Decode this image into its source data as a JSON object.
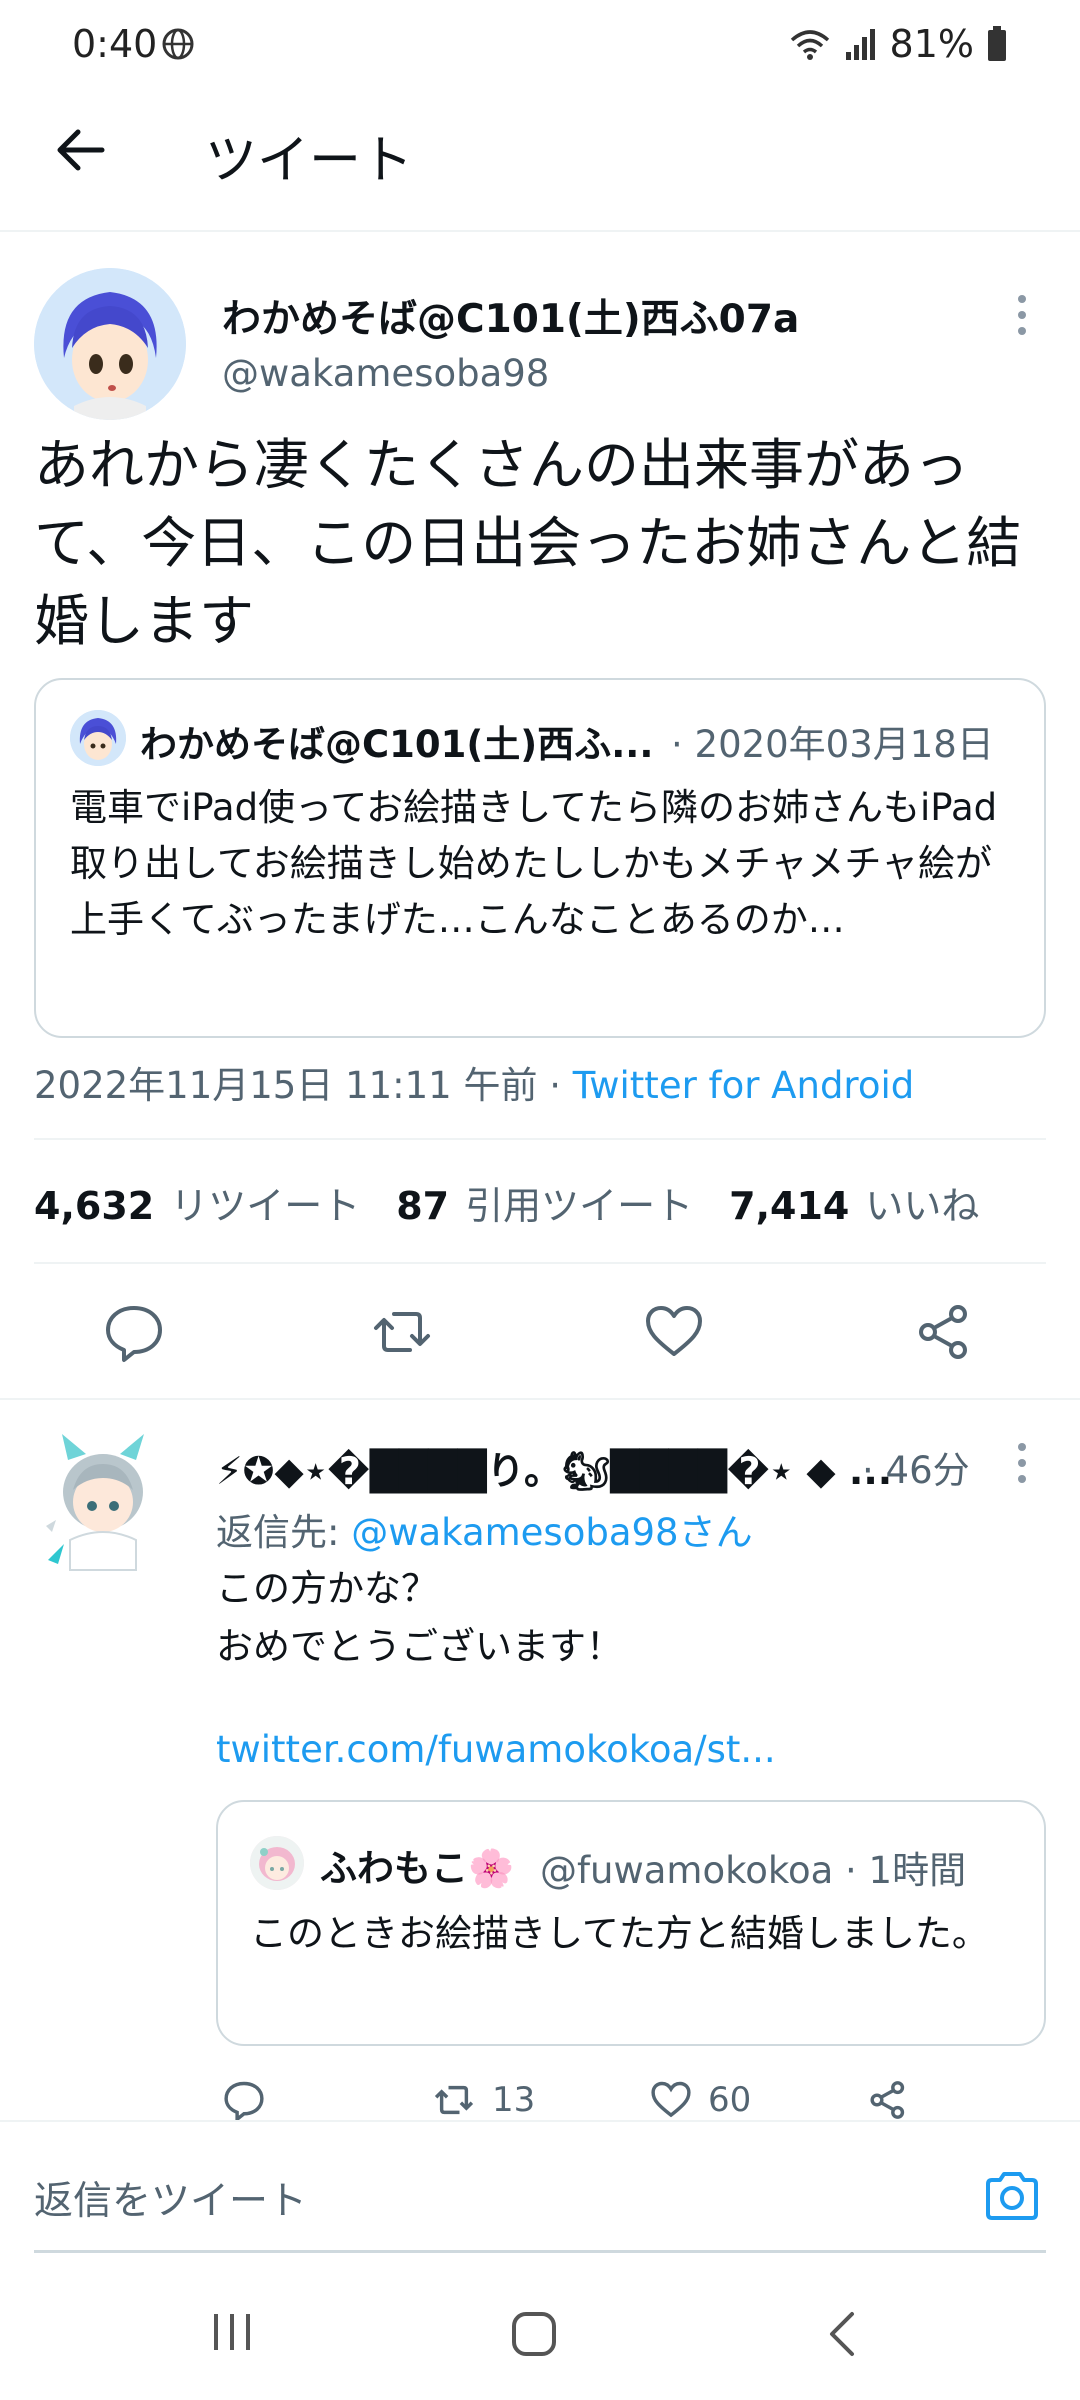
{
  "status_bar": {
    "time": "0:40",
    "battery": "81%"
  },
  "header": {
    "title": "ツイート"
  },
  "tweet": {
    "display_name": "わかめそば@C101(土)西ふ07a",
    "handle": "@wakamesoba98",
    "text": "あれから凄くたくさんの出来事があって、今日、この日出会ったお姉さんと結婚します",
    "quoted": {
      "display_name": "わかめそば@C101(土)西ふ...",
      "date": "· 2020年03月18日",
      "text": "電車でiPad使ってお絵描きしてたら隣のお姉さんもiPad取り出してお絵描きし始めたししかもメチャメチャ絵が上手くてぶったまげた…こんなことあるのか…"
    },
    "timestamp": "2022年11月15日 11:11 午前",
    "separator": " · ",
    "source": "Twitter for Android",
    "stats": {
      "retweets_count": "4,632",
      "retweets_label": "リツイート",
      "quotes_count": "87",
      "quotes_label": "引用ツイート",
      "likes_count": "7,414",
      "likes_label": "いいね"
    }
  },
  "reply": {
    "display_name": "⚡✪◆⋆�████り。🐿████�⋆ ◆ ...",
    "time": "· 46分",
    "reply_to_prefix": "返信先: ",
    "reply_to_mention": "@wakamesoba98さん",
    "text": "この方かな？\nおめでとうございます！",
    "link": "twitter.com/fuwamokokoa/st...",
    "quoted": {
      "display_name": "ふわもこ🌸",
      "handle_time": "@fuwamokokoa · 1時間",
      "text": "このときお絵描きしてた方と結婚しました。"
    },
    "retweet_count": "13",
    "like_count": "60"
  },
  "compose": {
    "placeholder": "返信をツイート"
  },
  "colors": {
    "accent": "#1d9bf0",
    "muted": "#536471",
    "text": "#0f1419"
  }
}
